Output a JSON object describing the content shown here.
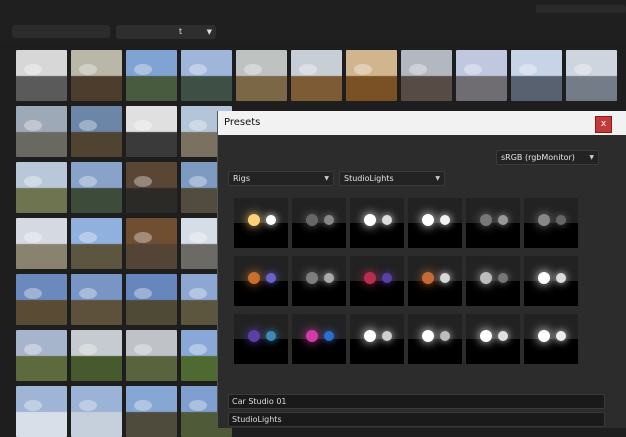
{
  "topbar": {
    "category_select_value": "t",
    "dropdown_icon": "chevron-down-icon"
  },
  "library": {
    "thumbnails": [
      {
        "sky": "#d7d7d7",
        "ground": "#5a5a5a"
      },
      {
        "sky": "#b8b7a8",
        "ground": "#4c3d2c"
      },
      {
        "sky": "#7fa3d2",
        "ground": "#495b3f"
      },
      {
        "sky": "#9fb6da",
        "ground": "#3e4f45"
      },
      {
        "sky": "#bec2c0",
        "ground": "#7b6645"
      },
      {
        "sky": "#c8ced5",
        "ground": "#7d5b34"
      },
      {
        "sky": "#d1b58e",
        "ground": "#7a5124"
      },
      {
        "sky": "#b2b7c0",
        "ground": "#574c45"
      },
      {
        "sky": "#bfc8df",
        "ground": "#706d72"
      },
      {
        "sky": "#c7d4e6",
        "ground": "#586170"
      },
      {
        "sky": "#cfd5df",
        "ground": "#747c88"
      },
      {
        "sky": "#9ea9b8",
        "ground": "#6a6961"
      },
      {
        "sky": "#6b86a6",
        "ground": "#4f4332"
      },
      {
        "sky": "#e0e0e0",
        "ground": "#3a3a3a"
      },
      {
        "sky": "#b3c6d9",
        "ground": "#7b7160"
      },
      {
        "sky": "#b9c8d8",
        "ground": "#6e7450"
      },
      {
        "sky": "#89a2c9",
        "ground": "#3d4b3b"
      },
      {
        "sky": "#5a4634",
        "ground": "#2c2a27"
      },
      {
        "sky": "#7d9ac1",
        "ground": "#524c40"
      },
      {
        "sky": "#d4d9e2",
        "ground": "#89826f"
      },
      {
        "sky": "#90b1dd",
        "ground": "#5c5640"
      },
      {
        "sky": "#6f4e32",
        "ground": "#544436"
      },
      {
        "sky": "#d5dde6",
        "ground": "#6b6a64"
      },
      {
        "sky": "#6c89be",
        "ground": "#5a4b35"
      },
      {
        "sky": "#7895c5",
        "ground": "#5d513c"
      },
      {
        "sky": "#6686bd",
        "ground": "#4e4a36"
      },
      {
        "sky": "#8da7d3",
        "ground": "#5d563f"
      },
      {
        "sky": "#a7b5cc",
        "ground": "#5d6a3e"
      },
      {
        "sky": "#c5cbd0",
        "ground": "#465a2d"
      },
      {
        "sky": "#bfc2c7",
        "ground": "#59633d"
      },
      {
        "sky": "#89a8d8",
        "ground": "#4e6a31"
      },
      {
        "sky": "#9fb5d5",
        "ground": "#d9dfe8"
      },
      {
        "sky": "#9bb3d6",
        "ground": "#c6cfdc"
      },
      {
        "sky": "#86a6d3",
        "ground": "#4e4b3c"
      },
      {
        "sky": "#7f9fd1",
        "ground": "#4f5a38"
      }
    ]
  },
  "dialog": {
    "title": "Presets",
    "close_label": "x",
    "colorspace_select": "sRGB (rgbMonitor)",
    "type_select": "Rigs",
    "group_select": "StudioLights",
    "presets": [
      {
        "lights": [
          "#ffd27a",
          "#ffffff"
        ]
      },
      {
        "lights": [
          "#666",
          "#888"
        ]
      },
      {
        "lights": [
          "#fff",
          "#ddd"
        ]
      },
      {
        "lights": [
          "#fff",
          "#f2f2f2"
        ]
      },
      {
        "lights": [
          "#777",
          "#999"
        ]
      },
      {
        "lights": [
          "#888",
          "#666"
        ]
      },
      {
        "lights": [
          "#c86f2c",
          "#6b62c8"
        ]
      },
      {
        "lights": [
          "#7e7e7e",
          "#aaaaaa"
        ]
      },
      {
        "lights": [
          "#b92e4f",
          "#5b3fa8"
        ]
      },
      {
        "lights": [
          "#c26b38",
          "#d8d8d8"
        ]
      },
      {
        "lights": [
          "#bdbdbd",
          "#777"
        ]
      },
      {
        "lights": [
          "#ffffff",
          "#dcdcdc"
        ]
      },
      {
        "lights": [
          "#5b3fa8",
          "#3f89b8"
        ]
      },
      {
        "lights": [
          "#d43aa7",
          "#2f6fc8"
        ]
      },
      {
        "lights": [
          "#fff",
          "#cfcfcf"
        ]
      },
      {
        "lights": [
          "#fff",
          "#bdbdbd"
        ]
      },
      {
        "lights": [
          "#fff",
          "#e0e0e0"
        ]
      },
      {
        "lights": [
          "#fff",
          "#ededed"
        ]
      }
    ],
    "preset_name": "Car Studio 01",
    "preset_group": "StudioLights"
  }
}
